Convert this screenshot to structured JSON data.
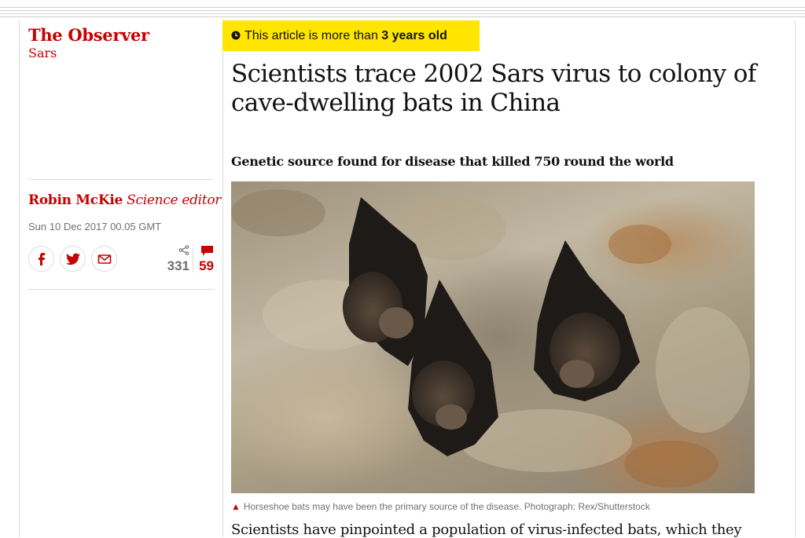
{
  "header": {
    "section_title": "The Observer",
    "section_sub": "Sars"
  },
  "byline": {
    "name": "Robin McKie",
    "role": "Science editor",
    "date": "Sun 10 Dec 2017 00.05 GMT"
  },
  "share": {
    "facebook_icon": "facebook-icon",
    "twitter_icon": "twitter-icon",
    "email_icon": "email-icon",
    "share_count": "331",
    "comment_count": "59"
  },
  "age_badge": {
    "prefix": "This article is more than ",
    "age": "3 years old"
  },
  "article": {
    "headline": "Scientists trace 2002 Sars virus to colony of cave-dwelling bats in China",
    "standfirst": "Genetic source found for disease that killed 750 round the world",
    "caption": "Horseshoe bats may have been the primary source of the disease. Photograph: Rex/Shutterstock",
    "body_start": "Scientists have pinpointed a population of virus-infected bats, which they"
  },
  "colors": {
    "accent": "#c70000",
    "badge": "#ffe500",
    "text": "#121212",
    "muted": "#707070"
  }
}
